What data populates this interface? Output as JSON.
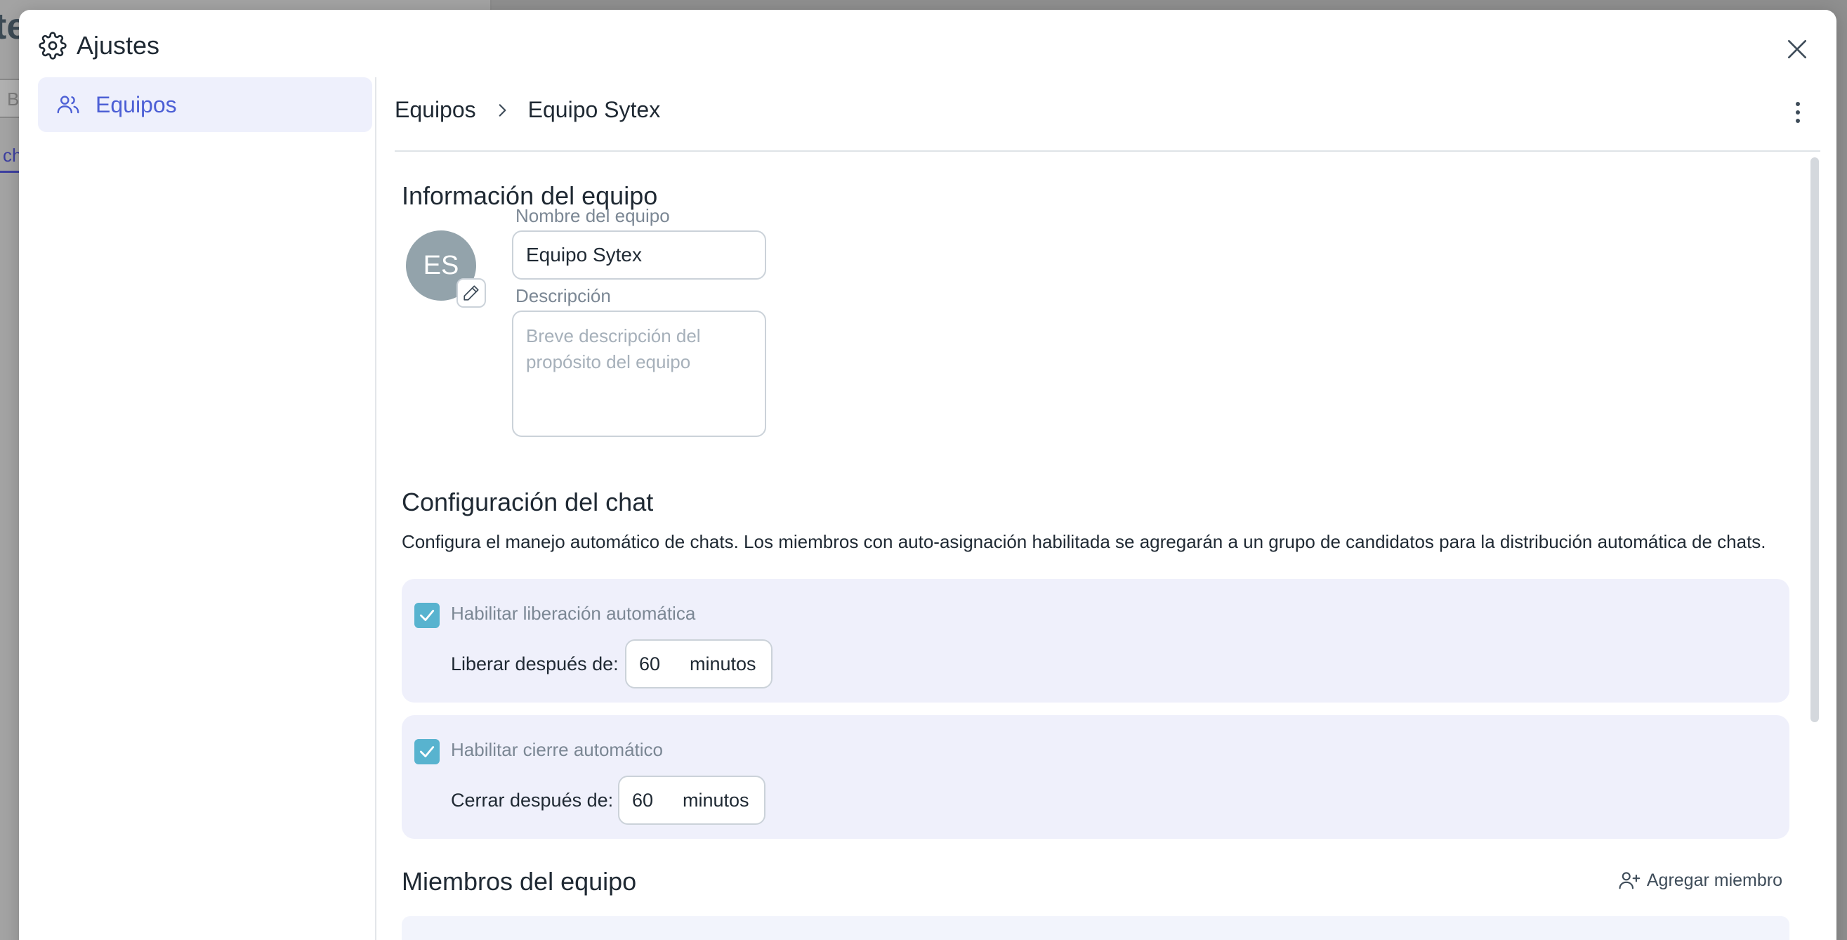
{
  "background": {
    "title_fragment": "te",
    "search_fragment": "B",
    "tab_fragment": "ch"
  },
  "modal": {
    "title": "Ajustes",
    "title_icon": "gear-icon",
    "close_icon": "close-icon"
  },
  "sidebar": {
    "items": [
      {
        "label": "Equipos",
        "icon": "users-icon",
        "active": true
      }
    ]
  },
  "breadcrumb": {
    "parent": "Equipos",
    "separator_icon": "chevron-right-icon",
    "current": "Equipo Sytex"
  },
  "team_info": {
    "heading": "Información del equipo",
    "avatar_initials": "ES",
    "name_label": "Nombre del equipo",
    "name_value": "Equipo Sytex",
    "description_label": "Descripción",
    "description_placeholder": "Breve descripción del propósito del equipo",
    "description_value": ""
  },
  "chat_config": {
    "heading": "Configuración del chat",
    "description": "Configura el manejo automático de chats. Los miembros con auto-asignación habilitada se agregarán a un grupo de candidatos para la distribución automática de chats.",
    "auto_release": {
      "checked": true,
      "label": "Habilitar liberación automática",
      "row_label": "Liberar después de:",
      "value": "60",
      "unit": "minutos"
    },
    "auto_close": {
      "checked": true,
      "label": "Habilitar cierre automático",
      "row_label": "Cerrar después de:",
      "value": "60",
      "unit": "minutos"
    }
  },
  "members": {
    "heading": "Miembros del equipo",
    "add_label": "Agregar miembro",
    "add_icon": "add-user-icon"
  },
  "colors": {
    "accent": "#4c5fd5",
    "sidebar_active_bg": "#eef0fc",
    "card_bg": "#eff0fb",
    "checkbox": "#58b3cf",
    "avatar_bg": "#93a3ab"
  }
}
